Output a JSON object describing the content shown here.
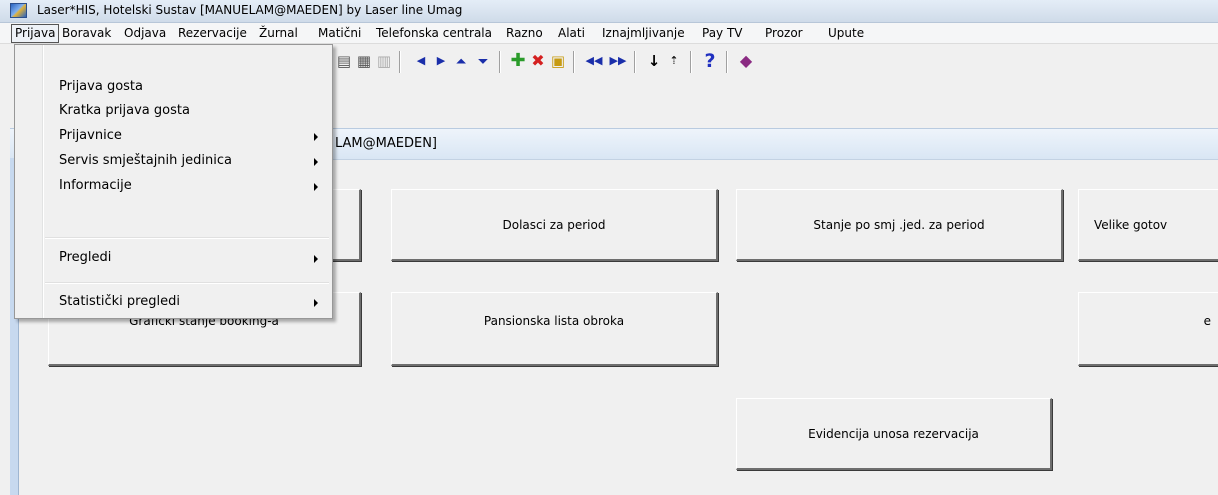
{
  "window": {
    "title": "Laser*HIS, Hotelski Sustav  [MANUELAM@MAEDEN]  by Laser line Umag",
    "app_icon": "laser-his-app-icon"
  },
  "menubar": {
    "items": [
      {
        "label": "Prijava"
      },
      {
        "label": "Boravak"
      },
      {
        "label": "Odjava"
      },
      {
        "label": "Rezervacije"
      },
      {
        "label": "Žurnal"
      },
      {
        "label": "Matični"
      },
      {
        "label": "Telefonska centrala"
      },
      {
        "label": "Razno"
      },
      {
        "label": "Alati"
      },
      {
        "label": "Iznajmljivanje"
      },
      {
        "label": "Pay TV"
      },
      {
        "label": "Prozor"
      },
      {
        "label": "Upute"
      }
    ],
    "active": "Prijava"
  },
  "toolbar": {
    "icons": [
      "find-record-icon",
      "copy-record-icon",
      "disabled-record-icon",
      "previous-record-icon",
      "next-record-icon",
      "first-record-icon",
      "last-record-icon",
      "add-record-icon",
      "delete-record-icon",
      "lock-record-icon",
      "page-back-icon",
      "page-forward-icon",
      "sort-down-icon",
      "sort-up-icon",
      "help-icon",
      "book-icon"
    ]
  },
  "dropdown": {
    "items": [
      {
        "label": "Prijava gosta",
        "submenu": false
      },
      {
        "label": "Kratka prijava gosta",
        "submenu": false
      },
      {
        "label": "Prijavnice",
        "submenu": true
      },
      {
        "label": "Servis smještajnih jedinica",
        "submenu": true
      },
      {
        "label": "Informacije",
        "submenu": true
      },
      {
        "label": "Pregledi",
        "submenu": true
      },
      {
        "label": "Statistički pregledi",
        "submenu": true
      }
    ]
  },
  "mdi": {
    "title_visible": "LAM@MAEDEN]"
  },
  "buttons": {
    "dolasci": "Dolasci za period",
    "stanje": "Stanje po smj .jed. za period",
    "velike": "Velike gotov",
    "graficki": "Grafički stanje booking-a",
    "pansionska": "Pansionska lista obroka",
    "e": "e",
    "evidencija": "Evidencija unosa rezervacija"
  },
  "colors": {
    "menu_highlight_border": "#555555",
    "mdi_header": "#d9e6f4",
    "background": "#f0f0f0"
  }
}
